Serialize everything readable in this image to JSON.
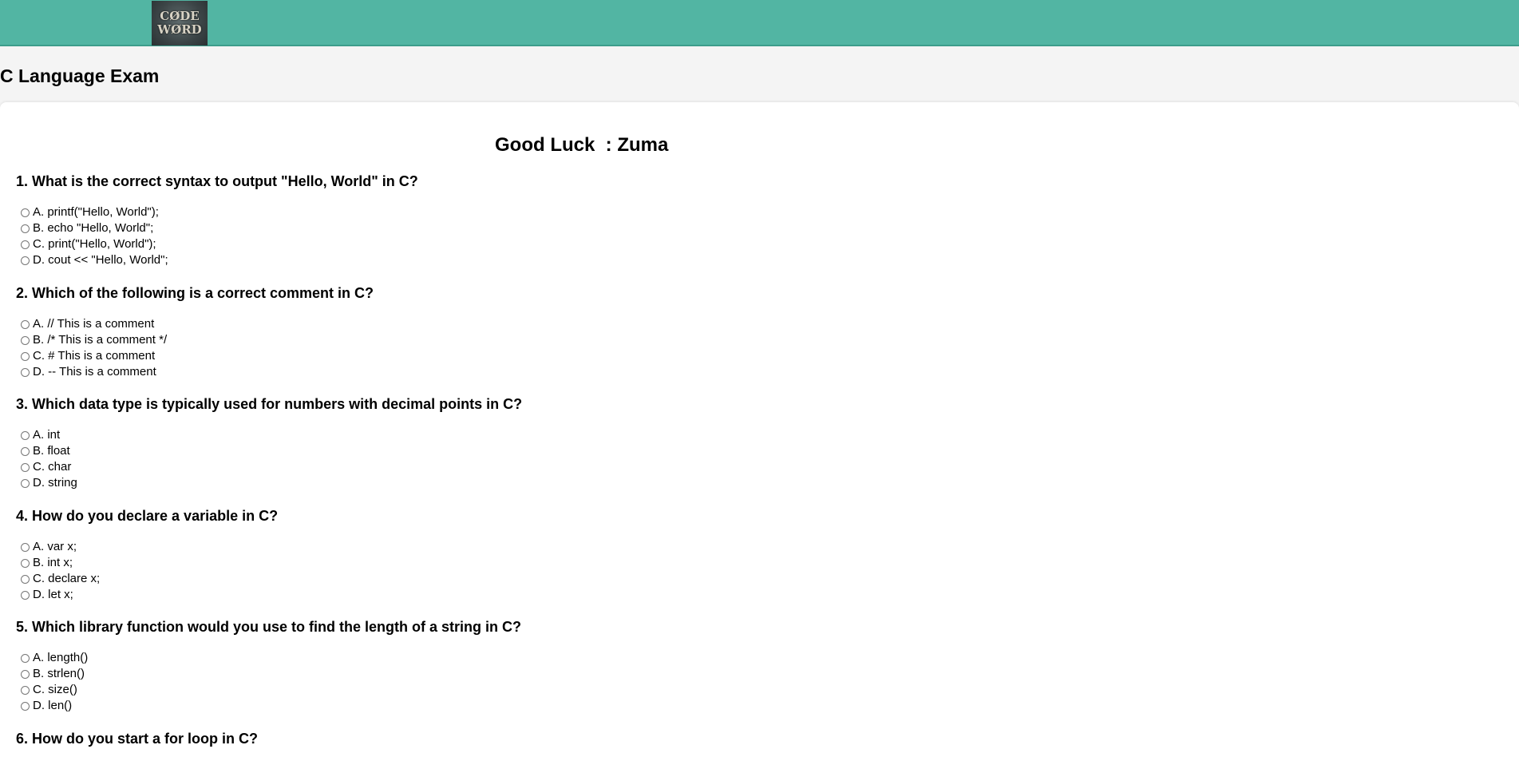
{
  "header": {
    "logo_line1": "CØDE",
    "logo_line2": "WØRD"
  },
  "page_title": "C Language Exam",
  "greeting": "Good Luck  : Zuma",
  "questions": [
    {
      "text": "1. What is the correct syntax to output \"Hello, World\" in C?",
      "options": [
        "A. printf(\"Hello, World\");",
        "B. echo \"Hello, World\";",
        "C. print(\"Hello, World\");",
        "D. cout << \"Hello, World\";"
      ]
    },
    {
      "text": "2. Which of the following is a correct comment in C?",
      "options": [
        "A. // This is a comment",
        "B. /* This is a comment */",
        "C. # This is a comment",
        "D. -- This is a comment"
      ]
    },
    {
      "text": "3. Which data type is typically used for numbers with decimal points in C?",
      "options": [
        "A. int",
        "B. float",
        "C. char",
        "D. string"
      ]
    },
    {
      "text": "4. How do you declare a variable in C?",
      "options": [
        "A. var x;",
        "B. int x;",
        "C. declare x;",
        "D. let x;"
      ]
    },
    {
      "text": "5. Which library function would you use to find the length of a string in C?",
      "options": [
        "A. length()",
        "B. strlen()",
        "C. size()",
        "D. len()"
      ]
    },
    {
      "text": "6. How do you start a for loop in C?",
      "options": []
    }
  ]
}
